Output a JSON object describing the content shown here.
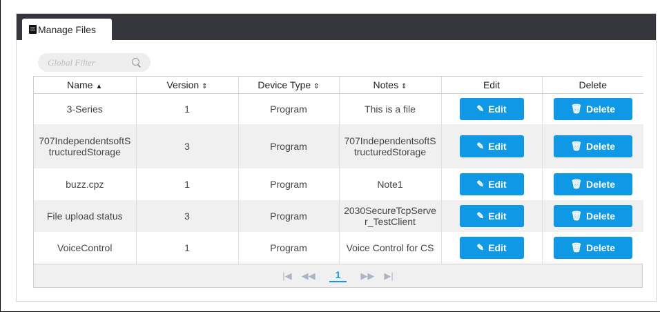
{
  "tab": {
    "label": "Manage Files",
    "icon": "file-icon"
  },
  "filter": {
    "placeholder": "Global Filter",
    "icon": "search-icon"
  },
  "table": {
    "columns": [
      {
        "label": "Name",
        "sort_glyph": "▲"
      },
      {
        "label": "Version",
        "sort_glyph": "⇕"
      },
      {
        "label": "Device Type",
        "sort_glyph": "⇕"
      },
      {
        "label": "Notes",
        "sort_glyph": "⇕"
      },
      {
        "label": "Edit",
        "sort_glyph": ""
      },
      {
        "label": "Delete",
        "sort_glyph": ""
      }
    ],
    "rows": [
      {
        "name": "3-Series",
        "version": "1",
        "device_type": "Program",
        "notes": "This is a file"
      },
      {
        "name": "707IndependentsoftStructuredStorage",
        "version": "3",
        "device_type": "Program",
        "notes": "707IndependentsoftStructuredStorage"
      },
      {
        "name": "buzz.cpz",
        "version": "1",
        "device_type": "Program",
        "notes": "Note1"
      },
      {
        "name": "File upload status",
        "version": "3",
        "device_type": "Program",
        "notes": "2030SecureTcpServer_TestClient"
      },
      {
        "name": "VoiceControl",
        "version": "1",
        "device_type": "Program",
        "notes": "Voice Control for CS"
      }
    ],
    "edit_label": "Edit",
    "delete_label": "Delete",
    "edit_icon": "pencil-square-icon",
    "delete_icon": "trash-icon"
  },
  "pagination": {
    "first": "|◀",
    "prev": "◀◀",
    "current": "1",
    "next": "▶▶",
    "last": "▶|"
  },
  "colors": {
    "tabbar": "#35373d",
    "accent": "#0f98e6",
    "row_alt": "#f0f0f0"
  }
}
